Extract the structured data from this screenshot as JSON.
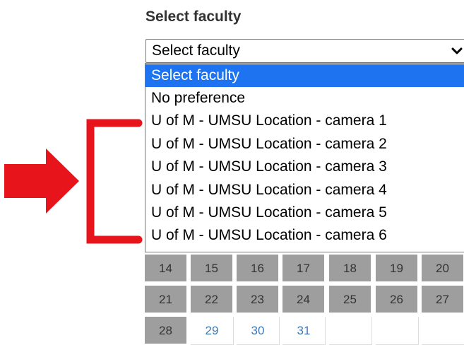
{
  "form": {
    "label": "Select faculty",
    "select_value": "Select faculty"
  },
  "dropdown": {
    "options": [
      "Select faculty",
      "No preference",
      "U of M - UMSU Location - camera 1",
      "U of M - UMSU Location - camera 2",
      "U of M - UMSU Location - camera 3",
      "U of M - UMSU Location - camera 4",
      "U of M - UMSU Location - camera 5",
      "U of M - UMSU Location - camera 6"
    ],
    "highlighted_index": 0
  },
  "calendar": {
    "rows": [
      [
        "14",
        "15",
        "16",
        "17",
        "18",
        "19",
        "20"
      ],
      [
        "21",
        "22",
        "23",
        "24",
        "25",
        "26",
        "27"
      ],
      [
        "28",
        "29",
        "30",
        "31",
        "",
        "",
        ""
      ]
    ],
    "past_through": "28"
  },
  "annotation": {
    "color": "#e8141b",
    "icons": [
      "right-arrow-icon",
      "bracket-icon"
    ]
  },
  "colors": {
    "option_highlight": "#1e74f0",
    "past_day_bg": "#9e9e9e",
    "future_day_text": "#3c78b4"
  }
}
